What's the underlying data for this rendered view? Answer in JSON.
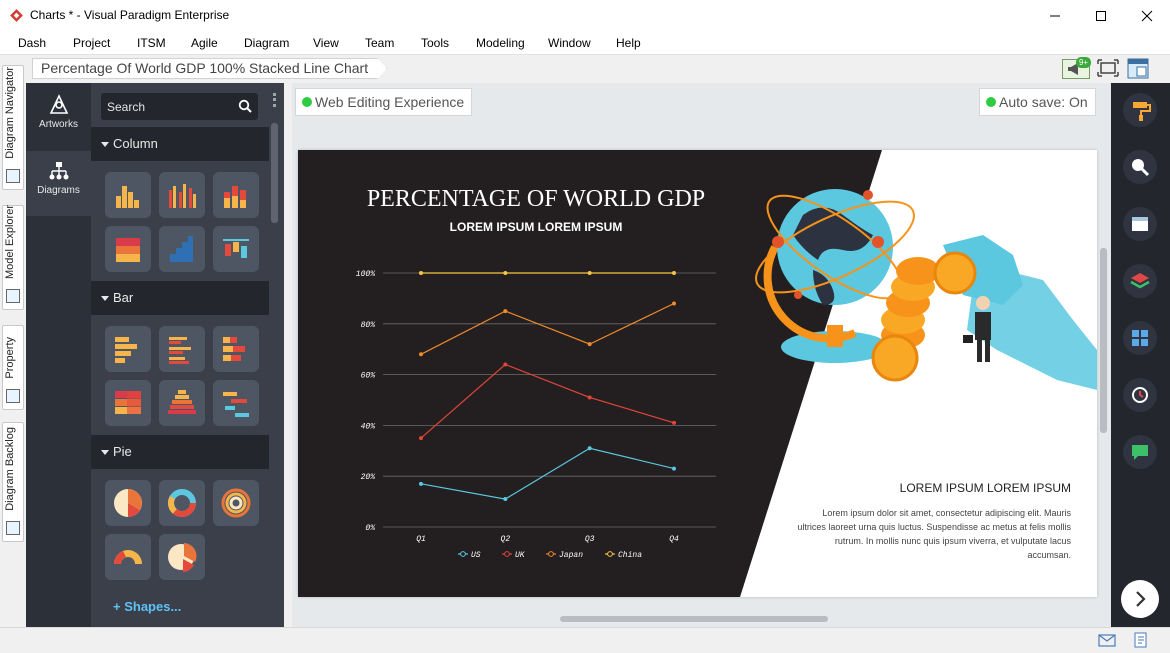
{
  "window": {
    "title": "Charts * - Visual Paradigm Enterprise"
  },
  "menu": [
    "Dash",
    "Project",
    "ITSM",
    "Agile",
    "Diagram",
    "View",
    "Team",
    "Tools",
    "Modeling",
    "Window",
    "Help"
  ],
  "breadcrumb": "Percentage Of World GDP 100% Stacked Line Chart",
  "notification_badge": "9+",
  "left_tabs": [
    "Diagram Navigator",
    "Model Explorer",
    "Property",
    "Diagram Backlog"
  ],
  "rail": {
    "artworks": "Artworks",
    "diagrams": "Diagrams"
  },
  "shape_panel": {
    "search_placeholder": "Search",
    "categories": [
      "Column",
      "Bar",
      "Pie"
    ],
    "shapes_link": "+ Shapes..."
  },
  "canvas": {
    "web_editing": "Web Editing Experience",
    "auto_save": "Auto save: On"
  },
  "slide": {
    "title": "PERCENTAGE OF WORLD GDP",
    "subtitle": "LOREM IPSUM LOREM IPSUM",
    "side_heading": "LOREM IPSUM LOREM IPSUM",
    "side_text": "Lorem ipsum dolor sit amet, consectetur adipiscing elit. Mauris ultrices laoreet urna quis luctus. Suspendisse ac metus at felis mollis rutrum. In mollis nunc quis ipsum viverra, et vulputate lacus accumsan."
  },
  "colors": {
    "slide_dark": "#231f20",
    "accent_blue": "#5bc8e0",
    "accent_orange": "#f7931a",
    "ok_green": "#2ecc40"
  },
  "chart_data": {
    "type": "line",
    "categories": [
      "Q1",
      "Q2",
      "Q3",
      "Q4"
    ],
    "ytick_labels": [
      "0%",
      "20%",
      "40%",
      "60%",
      "80%",
      "100%"
    ],
    "ylim": [
      0,
      100
    ],
    "grid": true,
    "legend_placement": "bottom",
    "series": [
      {
        "name": "US",
        "color": "#5bc8e0",
        "values": [
          17,
          11,
          31,
          23
        ]
      },
      {
        "name": "UK",
        "color": "#e0453a",
        "values": [
          35,
          64,
          51,
          41
        ]
      },
      {
        "name": "Japan",
        "color": "#f08a2c",
        "values": [
          68,
          85,
          72,
          88
        ]
      },
      {
        "name": "China",
        "color": "#f5c543",
        "values": [
          100,
          100,
          100,
          100
        ]
      }
    ]
  }
}
